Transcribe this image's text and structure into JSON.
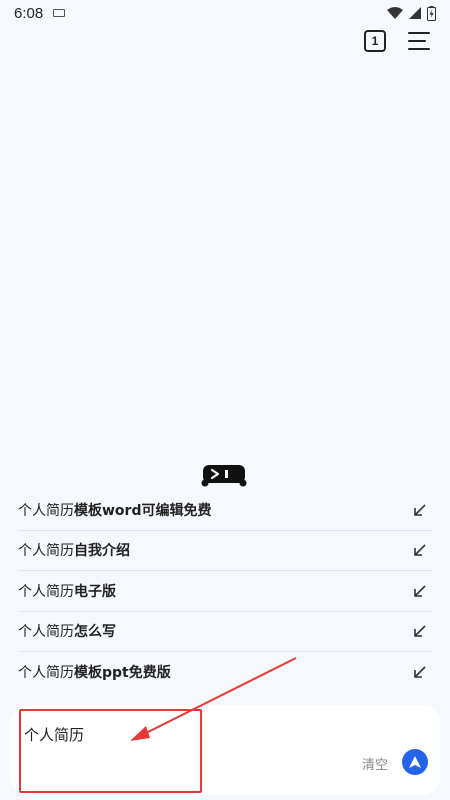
{
  "status_bar": {
    "time": "6:08"
  },
  "toolbar": {
    "tab_count": "1"
  },
  "suggestions": [
    {
      "prefix": "个人简历",
      "suffix": "模板word可编辑免费"
    },
    {
      "prefix": "个人简历",
      "suffix": "自我介绍"
    },
    {
      "prefix": "个人简历",
      "suffix": "电子版"
    },
    {
      "prefix": "个人简历",
      "suffix": "怎么写"
    },
    {
      "prefix": "个人简历",
      "suffix": "模板ppt免费版"
    }
  ],
  "input": {
    "query": "个人简历",
    "clear_label": "清空"
  },
  "colors": {
    "accent": "#2563eb",
    "annotation": "#e53935"
  }
}
